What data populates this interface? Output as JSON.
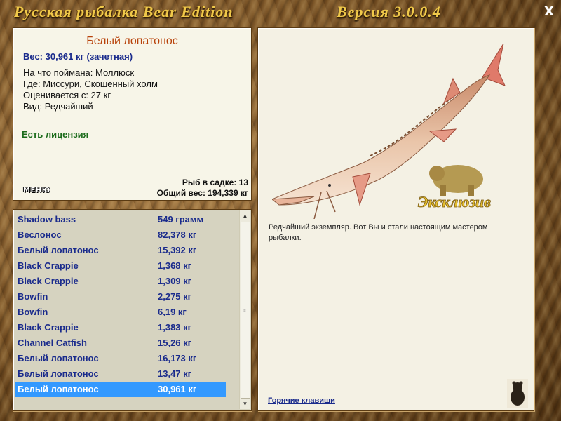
{
  "window": {
    "title": "Русская рыбалка Bear Edition",
    "version": "Версия 3.0.0.4",
    "close_glyph": "X"
  },
  "catch": {
    "fish_name": "Белый лопатонос",
    "weight_line": "Вес: 30,961 кг (зачетная)",
    "bait_line": "На что поймана: Моллюск",
    "place_line": "Где: Миссури, Скошенный холм",
    "rated_line": "Оценивается с: 27 кг",
    "kind_line": "Вид: Редчайший",
    "license": "Есть лицензия",
    "keepnet_count": "Рыб в садке: 13",
    "total_weight": "Общий вес: 194,339 кг",
    "menu_label": "МЕНЮ"
  },
  "keepnet": {
    "rows": [
      {
        "name": "Shadow bass",
        "weight": "549 грамм"
      },
      {
        "name": "Веслонос",
        "weight": "82,378 кг"
      },
      {
        "name": "Белый лопатонос",
        "weight": "15,392 кг"
      },
      {
        "name": "Black Crappie",
        "weight": "1,368 кг"
      },
      {
        "name": "Black Crappie",
        "weight": "1,309 кг"
      },
      {
        "name": "Bowfin",
        "weight": "2,275 кг"
      },
      {
        "name": "Bowfin",
        "weight": "6,19 кг"
      },
      {
        "name": "Black Crappie",
        "weight": "1,383 кг"
      },
      {
        "name": "Channel Catfish",
        "weight": "15,26 кг"
      },
      {
        "name": "Белый лопатонос",
        "weight": "16,173 кг"
      },
      {
        "name": "Белый лопатонос",
        "weight": "13,47 кг"
      },
      {
        "name": "Белый лопатонос",
        "weight": "30,961 кг"
      }
    ],
    "selected_index": 11
  },
  "photo": {
    "badge_text": "Эксклюзив",
    "description": "Редчайший экземпляр. Вот Вы и стали настоящим мастером рыбалки.",
    "hotkeys_link": "Горячие клавиши"
  },
  "colors": {
    "title_gold": "#f0c94a",
    "fish_name": "#b8420a",
    "list_text": "#1a2b8c",
    "license_green": "#1b6b1b",
    "selection": "#3399ff"
  }
}
